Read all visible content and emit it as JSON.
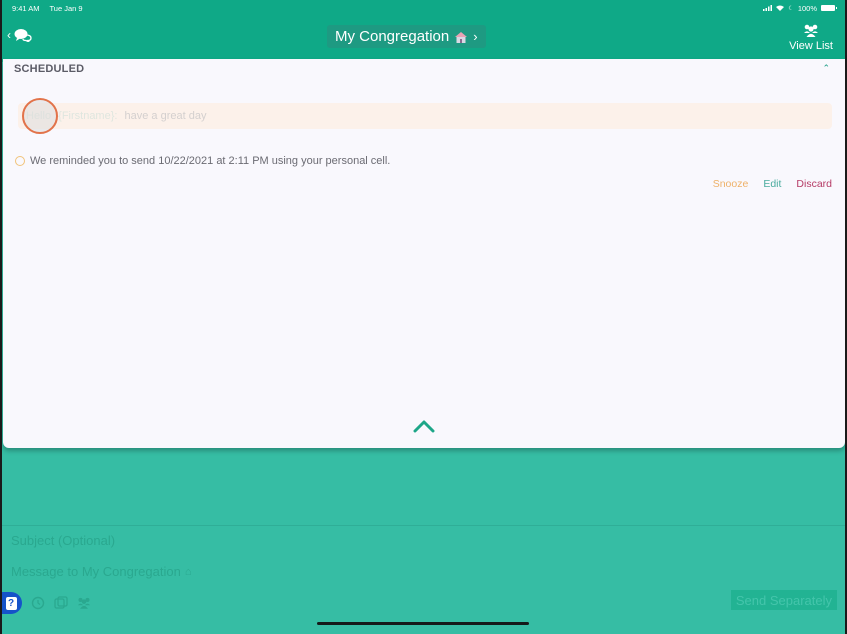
{
  "status_bar": {
    "time": "9:41 AM",
    "date": "Tue Jan 9",
    "battery": "100%"
  },
  "header": {
    "title": "My Congregation",
    "view_list_label": "View List",
    "icons": {
      "back": "chevron-left-icon",
      "chat": "chat-bubbles-icon",
      "title_emoji": "house-icon",
      "title_chevron": "chevron-right-icon",
      "view_list": "group-icon"
    }
  },
  "scheduled": {
    "section_title": "SCHEDULED",
    "message": {
      "token_1": "Hello",
      "token_2": "{Firstname}:",
      "text": "have a great day"
    },
    "reminder": "We reminded you to send  10/22/2021 at 2:11 PM using your personal cell.",
    "actions": {
      "snooze": "Snooze",
      "edit": "Edit",
      "discard": "Discard"
    }
  },
  "compose": {
    "subject_placeholder": "Subject (Optional)",
    "message_placeholder": "Message to My Congregation",
    "send_label": "Send Separately",
    "toolbar_icons": [
      "help-icon",
      "clock-icon",
      "media-icon",
      "group-icon"
    ]
  },
  "colors": {
    "header": "#0fa987",
    "compose_bg": "#36bda4",
    "snooze": "#eeb169",
    "edit": "#4aab9e",
    "discard": "#b53a65",
    "help": "#1553c9"
  }
}
